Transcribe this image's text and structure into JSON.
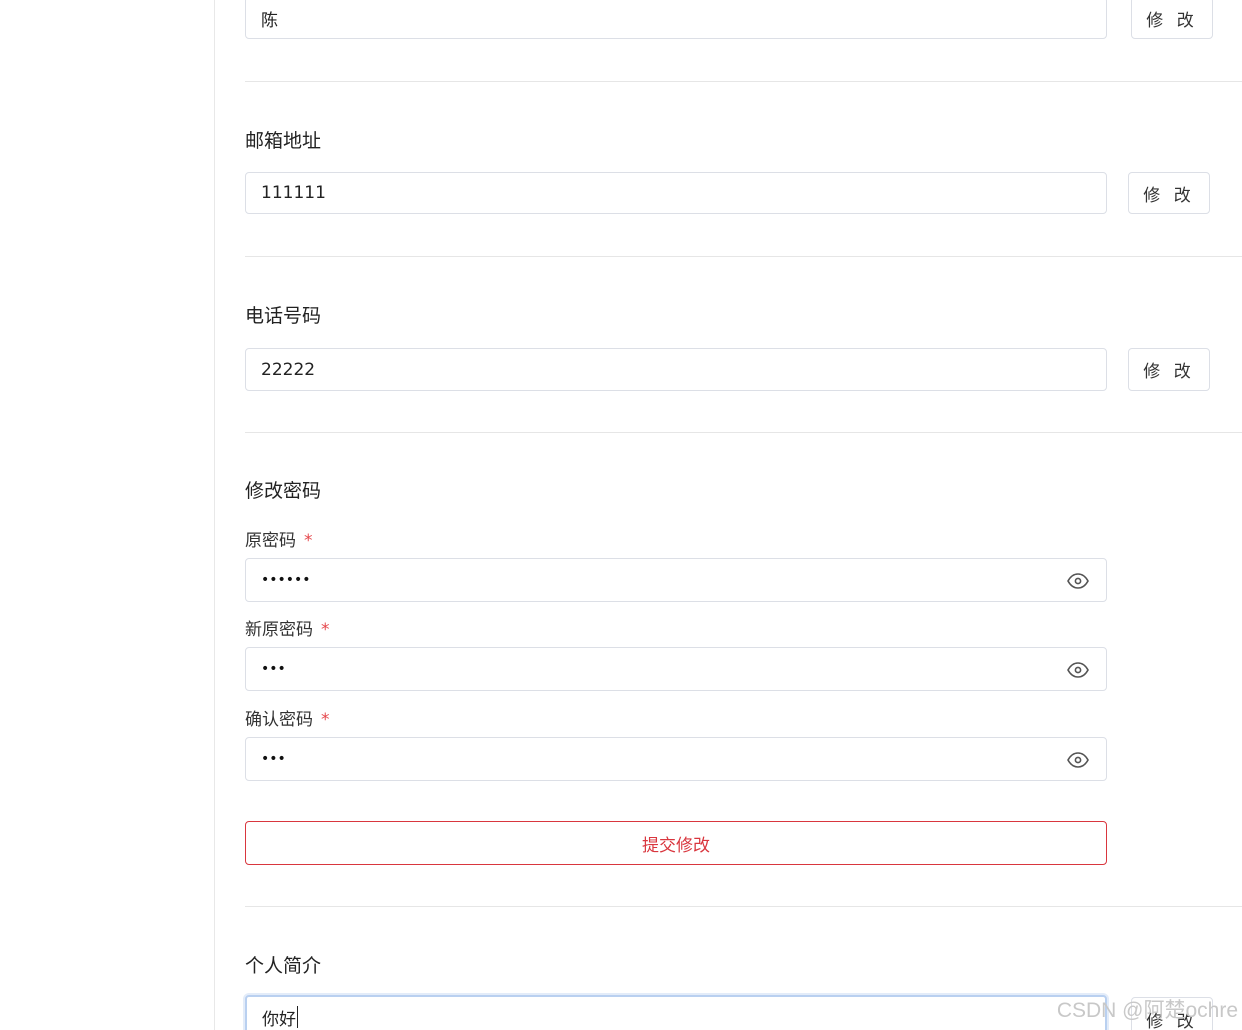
{
  "name_section": {
    "value": "陈",
    "modify_label": "修 改"
  },
  "email_section": {
    "title": "邮箱地址",
    "value": "111111",
    "modify_label": "修 改"
  },
  "phone_section": {
    "title": "电话号码",
    "value": "22222",
    "modify_label": "修 改"
  },
  "password_section": {
    "title": "修改密码",
    "fields": [
      {
        "label": "原密码",
        "required_mark": "*",
        "masked_value": "••••••"
      },
      {
        "label": "新原密码",
        "required_mark": "*",
        "masked_value": "•••"
      },
      {
        "label": "确认密码",
        "required_mark": "*",
        "masked_value": "•••"
      }
    ],
    "submit_label": "提交修改"
  },
  "bio_section": {
    "title": "个人简介",
    "value": "你好",
    "modify_label": "修 改"
  },
  "watermark": "CSDN @阿楚ochre"
}
